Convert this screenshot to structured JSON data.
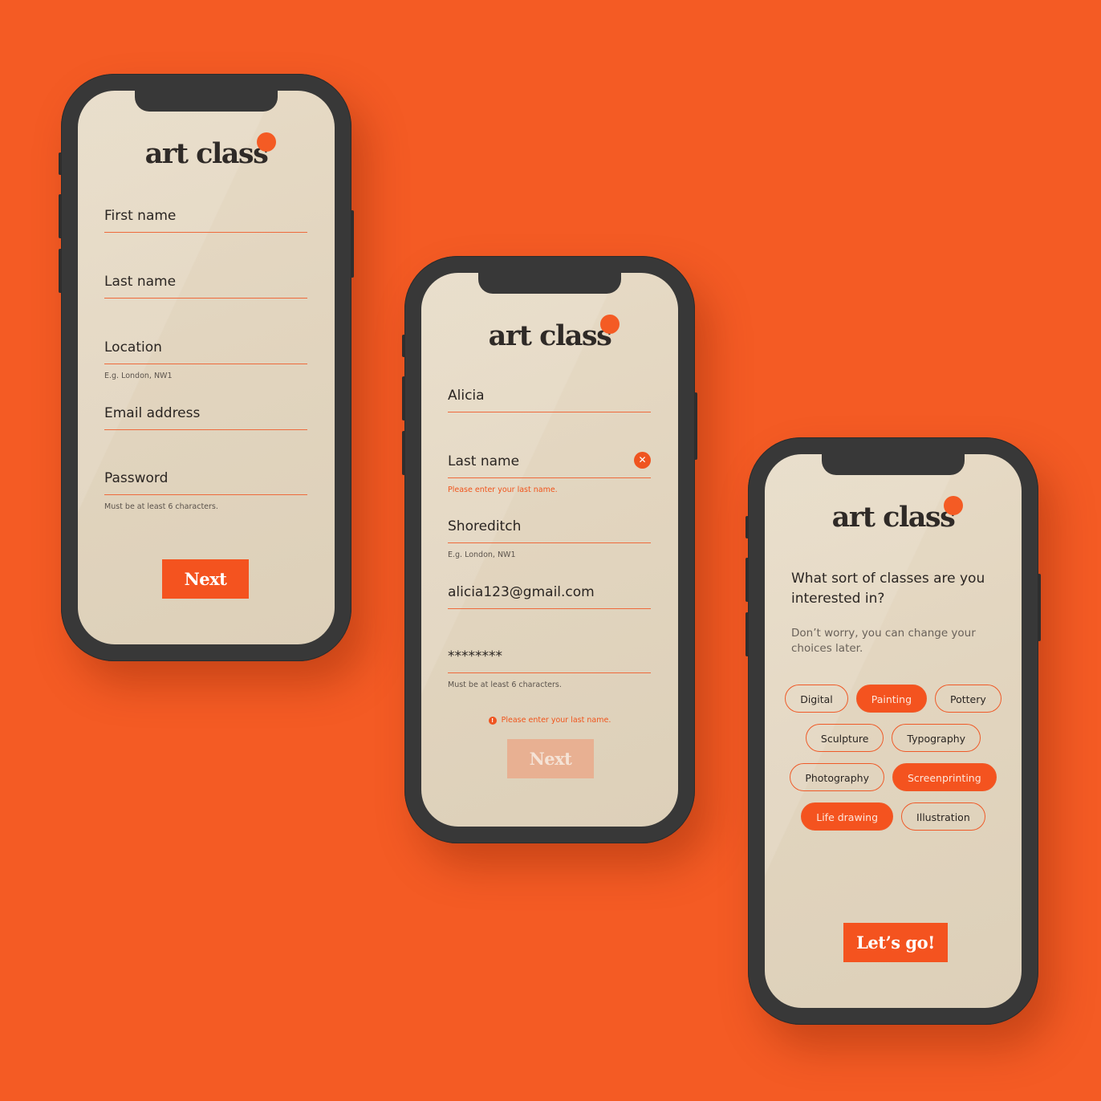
{
  "brand": {
    "name": "art class",
    "accent": "#f45b24"
  },
  "screen1": {
    "fields": [
      {
        "value": "First name",
        "hint": ""
      },
      {
        "value": "Last name",
        "hint": ""
      },
      {
        "value": "Location",
        "hint": "E.g. London, NW1"
      },
      {
        "value": "Email address",
        "hint": ""
      },
      {
        "value": "Password",
        "hint": "Must be at least 6 characters."
      }
    ],
    "next_label": "Next"
  },
  "screen2": {
    "fields": [
      {
        "value": "Alicia",
        "hint": ""
      },
      {
        "value": "Last name",
        "error": "Please enter your last name."
      },
      {
        "value": "Shoreditch",
        "hint": "E.g. London, NW1"
      },
      {
        "value": "alicia123@gmail.com",
        "hint": ""
      },
      {
        "value": "********",
        "hint": "Must be at least 6 characters."
      }
    ],
    "form_error": "Please enter your last name.",
    "next_label": "Next"
  },
  "screen3": {
    "question": "What sort of classes are you interested in?",
    "subtext": "Don’t worry, you can change your choices later.",
    "chips": [
      {
        "label": "Digital",
        "selected": false
      },
      {
        "label": "Painting",
        "selected": true
      },
      {
        "label": "Pottery",
        "selected": false
      },
      {
        "label": "Sculpture",
        "selected": false
      },
      {
        "label": "Typography",
        "selected": false
      },
      {
        "label": "Photography",
        "selected": false
      },
      {
        "label": "Screenprinting",
        "selected": true
      },
      {
        "label": "Life drawing",
        "selected": true
      },
      {
        "label": "Illustration",
        "selected": false
      }
    ],
    "go_label": "Let’s go!"
  }
}
